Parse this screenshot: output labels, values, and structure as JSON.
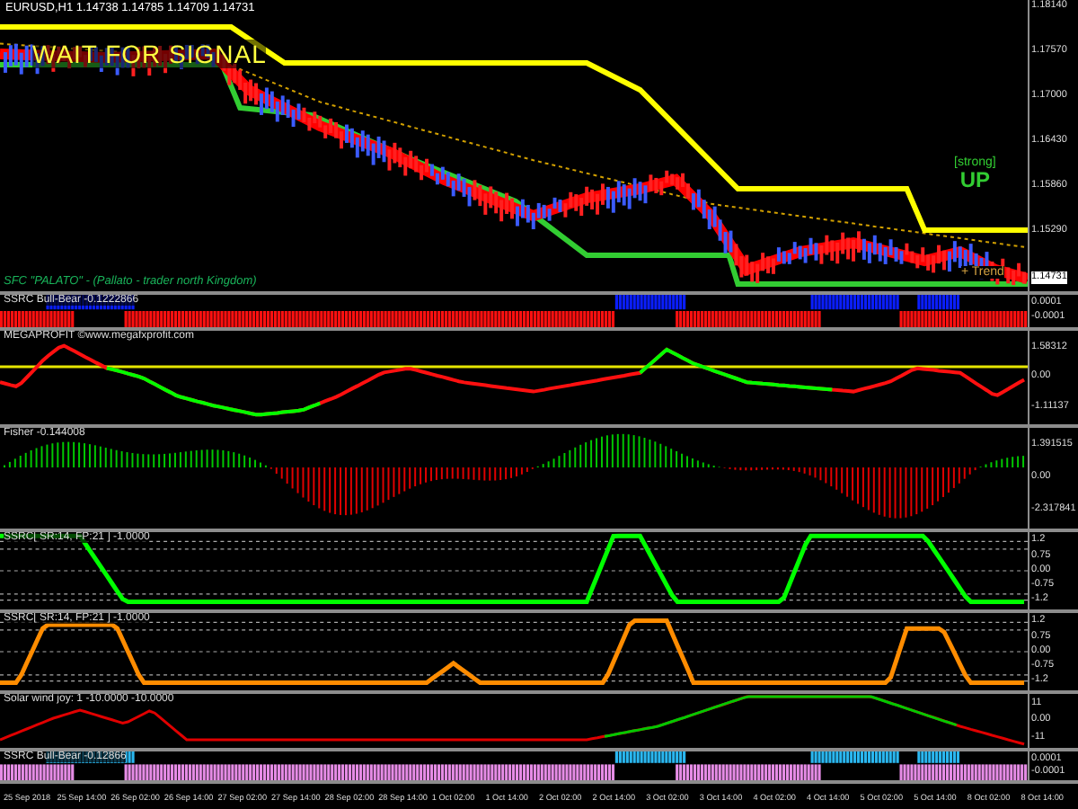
{
  "chart": {
    "title": "EURUSD,H1  1.14738 1.14785 1.14709 1.14731"
  },
  "main_panel": {
    "signal": "WAIT FOR SIGNAL",
    "strength": "[strong]",
    "direction": "UP",
    "trend": "+ Trend",
    "credit": "SFC \"PALATO\" - (Pallato - trader north Kingdom)",
    "price_axis": [
      "1.18140",
      "1.17570",
      "1.17000",
      "1.16430",
      "1.15860",
      "1.15290"
    ],
    "current_price": "1.14731"
  },
  "indicators": [
    {
      "kind": "bars",
      "label": "SSRC Bull-Bear -0.1222866",
      "axis": [
        "0.0001",
        "-0.0001"
      ]
    },
    {
      "kind": "cross",
      "label": "MEGAPROFIT ©www.megafxprofit.com",
      "axis": [
        "1.58312",
        "0.00",
        "-1.11137"
      ]
    },
    {
      "kind": "histogram",
      "label": "Fisher -0.144008",
      "axis": [
        "1.391515",
        "0.00",
        "-2.317841"
      ]
    },
    {
      "kind": "ssrc",
      "color": "#00ff00",
      "label": "SSRC[ SR:14, FP:21 ] -1.0000",
      "axis": [
        "1.2",
        "0.75",
        "0.00",
        "-0.75",
        "-1.2"
      ]
    },
    {
      "kind": "ssrc",
      "color": "#ff8c00",
      "label": "SSRC[ SR:14, FP:21 ] -1.0000",
      "axis": [
        "1.2",
        "0.75",
        "0.00",
        "-0.75",
        "-1.2"
      ]
    },
    {
      "kind": "wave",
      "label": "Solar wind joy: 1 -10.0000 -10.0000",
      "axis": [
        "11",
        "0.00",
        "-11"
      ]
    },
    {
      "kind": "bars2",
      "label": "SSRC Bull-Bear -0.12866",
      "axis": [
        "0.0001",
        "-0.0001"
      ]
    }
  ],
  "time_axis": [
    "25 Sep 2018",
    "25 Sep 14:00",
    "26 Sep 02:00",
    "26 Sep 14:00",
    "27 Sep 02:00",
    "27 Sep 14:00",
    "28 Sep 02:00",
    "28 Sep 14:00",
    "1 Oct 02:00",
    "1 Oct 14:00",
    "2 Oct 02:00",
    "2 Oct 14:00",
    "3 Oct 02:00",
    "3 Oct 14:00",
    "4 Oct 02:00",
    "4 Oct 14:00",
    "5 Oct 02:00",
    "5 Oct 14:00",
    "8 Oct 02:00",
    "8 Oct 14:00"
  ]
}
